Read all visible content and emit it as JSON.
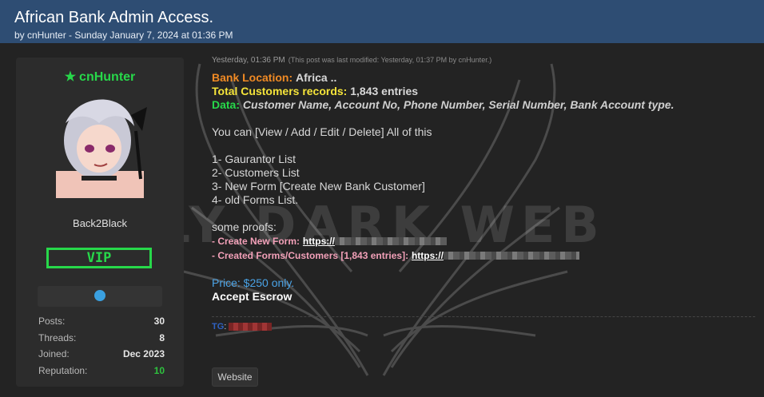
{
  "thread": {
    "title": "African Bank Admin Access.",
    "meta": "by cnHunter - Sunday January 7, 2024 at 01:36 PM"
  },
  "watermark": {
    "text": "DAILY DARK WEB"
  },
  "user": {
    "name": "cnHunter",
    "title": "Back2Black",
    "badge": "VIP",
    "contact_icon": "telegram-icon",
    "stats": [
      {
        "label": "Posts:",
        "value": "30"
      },
      {
        "label": "Threads:",
        "value": "8"
      },
      {
        "label": "Joined:",
        "value": "Dec 2023"
      },
      {
        "label": "Reputation:",
        "value": "10"
      }
    ]
  },
  "post": {
    "date": "Yesterday, 01:36 PM",
    "edit_note": "(This post was last modified: Yesterday, 01:37 PM by cnHunter.)",
    "bank_location_label": "Bank Location:",
    "bank_location_value": "Africa ..",
    "total_label": "Total Customers records:",
    "total_value": "1,843 entries",
    "data_label": "Data:",
    "data_value": "Customer Name, Account No, Phone Number, Serial Number, Bank Account type.",
    "can_text": "You can [View / Add / Edit / Delete] All of this",
    "list": [
      "1- Gaurantor List",
      "2- Customers List",
      "3- New Form [Create New Bank Customer]",
      "4- old Forms List."
    ],
    "proofs_heading": "some proofs:",
    "proof1_label": "- Create New Form:",
    "proof1_url": "https://",
    "proof2_label": "- Created Forms/Customers [1,843 entries]:",
    "proof2_url": "https://",
    "price": "Price: $250 only.",
    "escrow": "Accept Escrow",
    "sig_label": "TG",
    "sig_colon": ":"
  },
  "buttons": {
    "website": "Website"
  },
  "colors": {
    "header": "#2e4d73",
    "background": "#232323",
    "username": "#27d84a",
    "orange": "#f08a24",
    "yellow": "#f5e43a",
    "price": "#4aa3e6"
  }
}
